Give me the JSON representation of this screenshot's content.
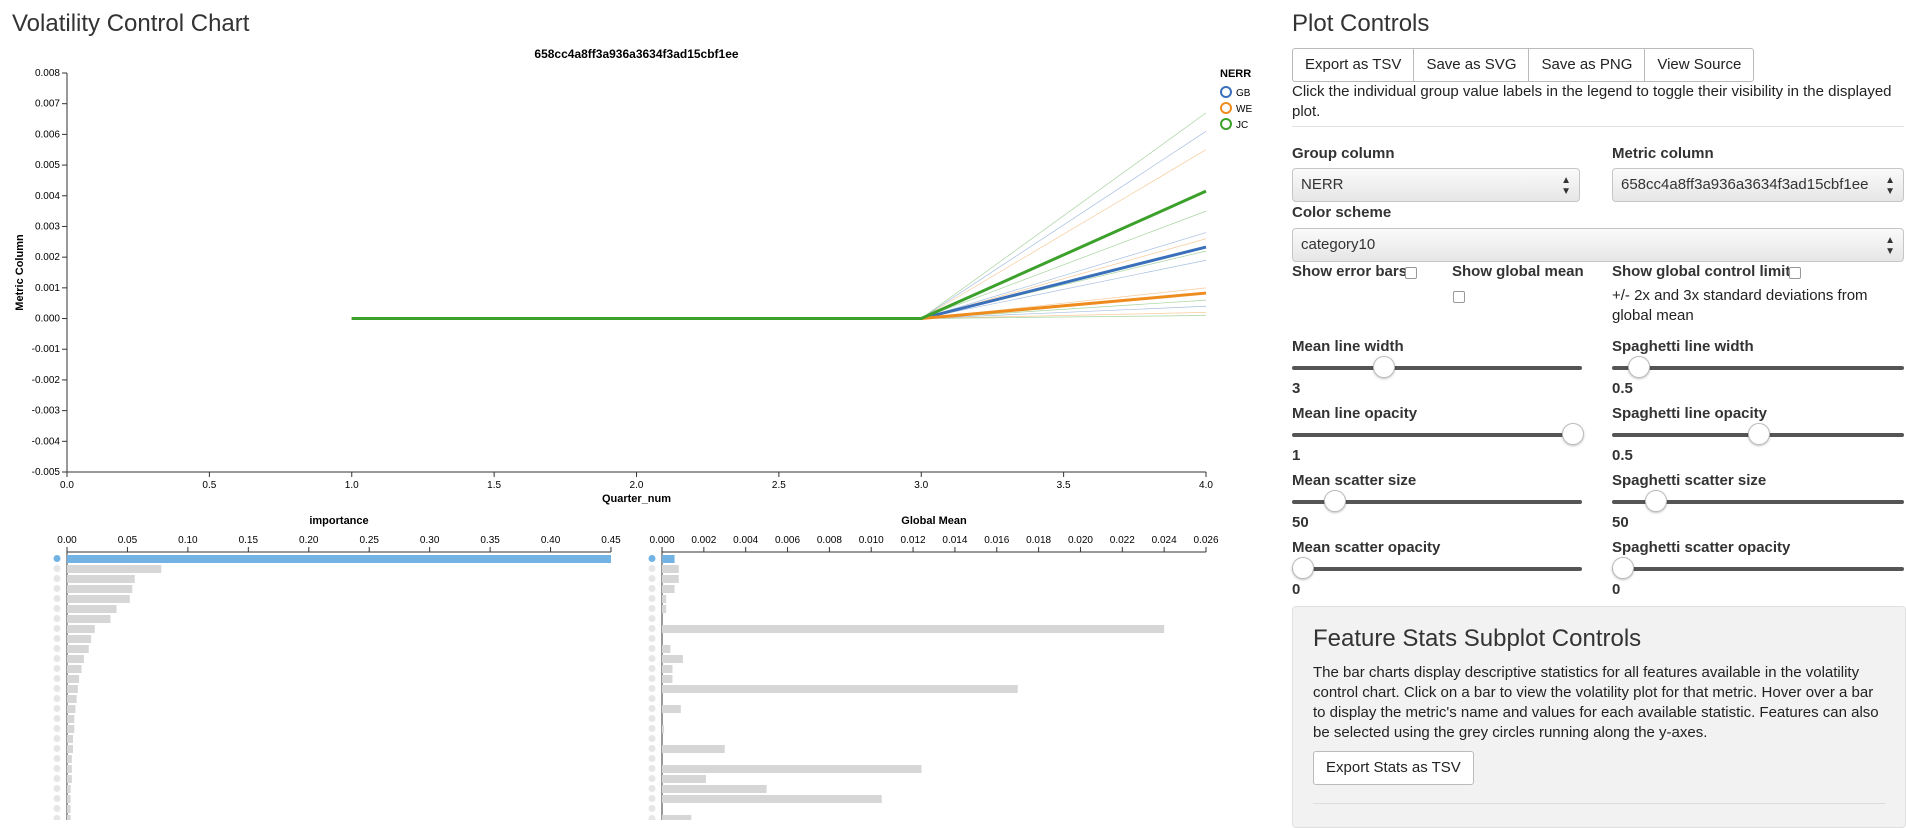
{
  "chart_panel": {
    "title": "Volatility Control Chart"
  },
  "controls_panel": {
    "title": "Plot Controls",
    "buttons": [
      "Export as TSV",
      "Save as SVG",
      "Save as PNG",
      "View Source"
    ],
    "legend_help": "Click the individual group value labels in the legend to toggle their visibility in the displayed plot.",
    "group_column": {
      "label": "Group column",
      "value": "NERR"
    },
    "metric_column": {
      "label": "Metric column",
      "value": "658cc4a8ff3a936a3634f3ad15cbf1ee"
    },
    "color_scheme": {
      "label": "Color scheme",
      "value": "category10"
    },
    "show_error_bars": {
      "label": "Show error bars",
      "checked": false
    },
    "show_global_mean": {
      "label": "Show global mean",
      "checked": false
    },
    "show_global_control_limits": {
      "label": "Show global control limits",
      "checked": false,
      "help": "+/- 2x and 3x standard deviations from global mean"
    },
    "sliders": {
      "mean_line_width": {
        "label": "Mean line width",
        "value": "3",
        "fraction": 0.3
      },
      "spaghetti_line_width": {
        "label": "Spaghetti line width",
        "value": "0.5",
        "fraction": 0.06
      },
      "mean_line_opacity": {
        "label": "Mean line opacity",
        "value": "1",
        "fraction": 1.0
      },
      "spaghetti_line_opacity": {
        "label": "Spaghetti line opacity",
        "value": "0.5",
        "fraction": 0.5
      },
      "mean_scatter_size": {
        "label": "Mean scatter size",
        "value": "50",
        "fraction": 0.12
      },
      "spaghetti_scatter_size": {
        "label": "Spaghetti scatter size",
        "value": "50",
        "fraction": 0.12
      },
      "mean_scatter_opacity": {
        "label": "Mean scatter opacity",
        "value": "0",
        "fraction": 0.0
      },
      "spaghetti_scatter_opacity": {
        "label": "Spaghetti scatter opacity",
        "value": "0",
        "fraction": 0.0
      }
    }
  },
  "feature_controls": {
    "title": "Feature Stats Subplot Controls",
    "description": "The bar charts display descriptive statistics for all features available in the volatility control chart. Click on a bar to view the volatility plot for that metric. Hover over a bar to display the metric's name and values for each available statistic. Features can also be selected using the grey circles running along the y-axes.",
    "export_button": "Export Stats as TSV"
  },
  "colors": {
    "GB": "#3a6fba",
    "WE": "#ee8c1e",
    "JC": "#3ba12b",
    "bar": "#d6d6d6",
    "selected_bar": "#72b3e4"
  },
  "chart_data": [
    {
      "type": "line",
      "title": "658cc4a8ff3a936a3634f3ad15cbf1ee",
      "xlabel": "Quarter_num",
      "ylabel": "Metric Column",
      "xlim": [
        0.0,
        4.0
      ],
      "ylim": [
        -0.005,
        0.008
      ],
      "x_ticks": [
        "0.0",
        "0.5",
        "1.0",
        "1.5",
        "2.0",
        "2.5",
        "3.0",
        "3.5",
        "4.0"
      ],
      "y_ticks": [
        "0.008",
        "0.007",
        "0.006",
        "0.005",
        "0.004",
        "0.003",
        "0.002",
        "0.001",
        "0.000",
        "-0.001",
        "-0.002",
        "-0.003",
        "-0.004",
        "-0.005"
      ],
      "legend_title": "NERR",
      "legend_position": "top-right",
      "series": [
        {
          "name": "GB",
          "x": [
            1,
            2,
            3,
            4
          ],
          "y": [
            0,
            0,
            0,
            0.00233
          ]
        },
        {
          "name": "WE",
          "x": [
            1,
            2,
            3,
            4
          ],
          "y": [
            0,
            0,
            0,
            0.00083
          ]
        },
        {
          "name": "JC",
          "x": [
            1,
            2,
            3,
            4
          ],
          "y": [
            0,
            0,
            0,
            0.00415
          ]
        }
      ],
      "spaghetti_end_values": [
        0.0067,
        0.0061,
        0.0055,
        0.0035,
        0.0028,
        0.0026,
        0.0022,
        0.0019,
        0.001,
        0.0006,
        0.0004,
        0.0002,
        0.0001
      ]
    },
    {
      "type": "bar",
      "orientation": "horizontal",
      "title": "importance",
      "xlim": [
        0,
        0.45
      ],
      "x_ticks": [
        "0.00",
        "0.05",
        "0.10",
        "0.15",
        "0.20",
        "0.25",
        "0.30",
        "0.35",
        "0.40",
        "0.45"
      ],
      "selected_index": 0,
      "values": [
        0.45,
        0.078,
        0.056,
        0.054,
        0.052,
        0.041,
        0.036,
        0.023,
        0.02,
        0.018,
        0.014,
        0.012,
        0.01,
        0.009,
        0.008,
        0.007,
        0.006,
        0.006,
        0.005,
        0.005,
        0.004,
        0.004,
        0.004,
        0.003,
        0.003,
        0.003,
        0.003,
        0.002
      ]
    },
    {
      "type": "bar",
      "orientation": "horizontal",
      "title": "Global Mean",
      "xlim": [
        0,
        0.026
      ],
      "x_ticks": [
        "0.000",
        "0.002",
        "0.004",
        "0.006",
        "0.008",
        "0.010",
        "0.012",
        "0.014",
        "0.016",
        "0.018",
        "0.020",
        "0.022",
        "0.024",
        "0.026"
      ],
      "selected_index": 0,
      "values": [
        0.0006,
        0.0008,
        0.0008,
        0.0006,
        0.0002,
        0.0002,
        0,
        0.024,
        0,
        0.0004,
        0.001,
        0.0005,
        0.0005,
        0.017,
        0,
        0.0009,
        0,
        0.0001,
        0,
        0.003,
        0,
        0.0124,
        0.0021,
        0.005,
        0.0105,
        0,
        0.0014,
        0.0002
      ]
    }
  ]
}
